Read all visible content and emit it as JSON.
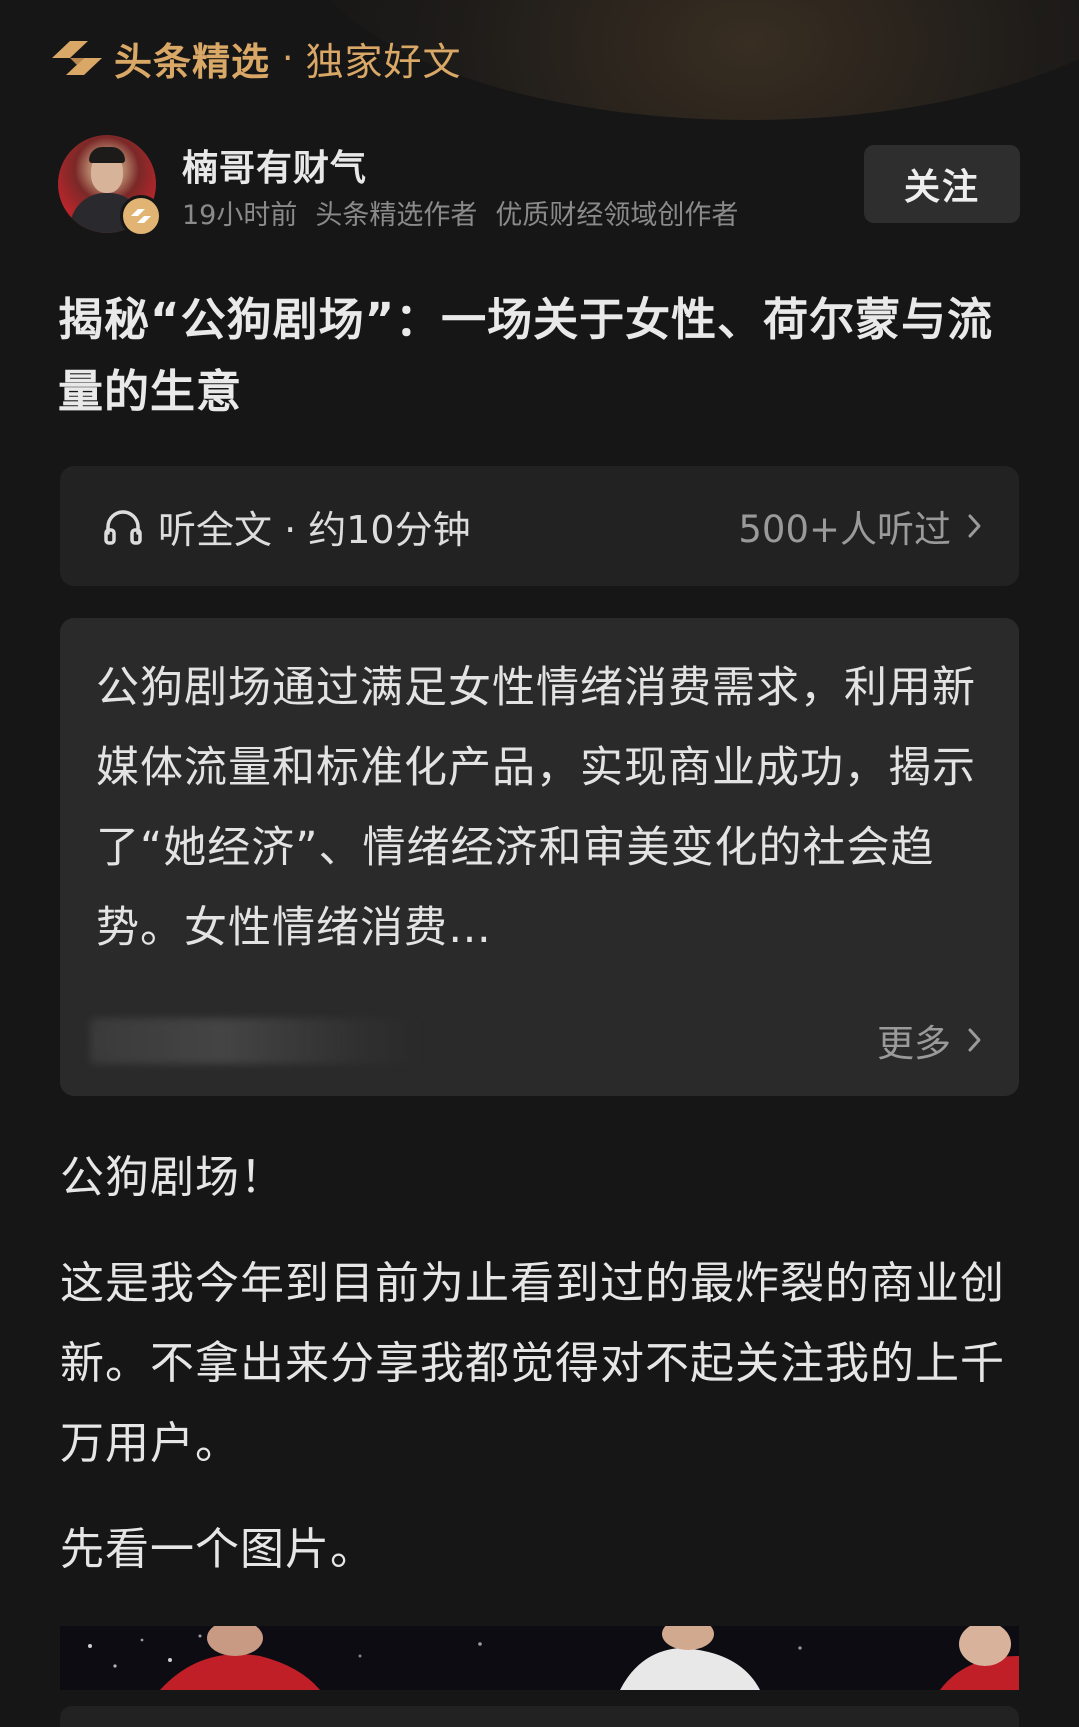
{
  "header": {
    "brand": "头条精选",
    "separator": "·",
    "subtitle": "独家好文"
  },
  "author": {
    "name": "楠哥有财气",
    "time": "19小时前",
    "badge_1": "头条精选作者",
    "badge_2": "优质财经领域创作者",
    "follow_label": "关注"
  },
  "article": {
    "title": "揭秘“公狗剧场”：一场关于女性、荷尔蒙与流量的生意"
  },
  "listen": {
    "label": "听全文 · 约10分钟",
    "count": "500+人听过"
  },
  "summary": {
    "text": "公狗剧场通过满足女性情绪消费需求，利用新媒体流量和标准化产品，实现商业成功，揭示了“她经济”、情绪经济和审美变化的社会趋势。女性情绪消费…",
    "more_label": "更多"
  },
  "body": {
    "p1": "公狗剧场！",
    "p2": "这是我今年到目前为止看到过的最炸裂的商业创新。不拿出来分享我都觉得对不起关注我的上千万用户。",
    "p3": "先看一个图片。"
  },
  "colors": {
    "background": "#161616",
    "brand_gold": "#d9a766",
    "card": "#222222",
    "summary_card": "#2a2a2a",
    "muted_text": "#9a9a9a"
  },
  "icons": {
    "brand": "toutiao-logo-icon",
    "verify": "verified-badge-icon",
    "listen": "headphones-icon",
    "chevron": "chevron-right-icon"
  }
}
